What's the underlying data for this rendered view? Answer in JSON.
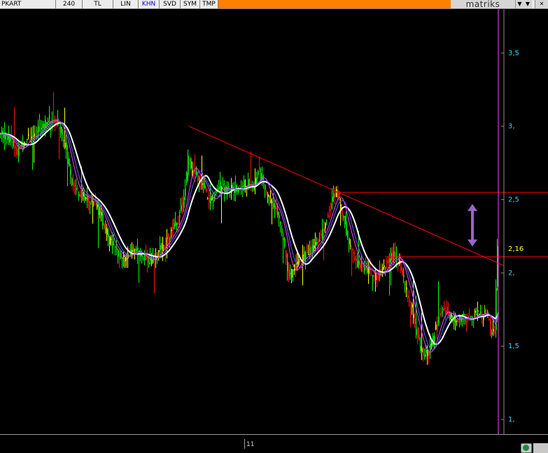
{
  "toolbar": {
    "symbol": "PKART",
    "period": "240",
    "buttons": [
      "TL",
      "LIN",
      "KHN",
      "SVD",
      "SYM",
      "TMP"
    ],
    "active_button": "KHN",
    "brand": "matriks",
    "dropdown_icon": "chevron-down-icon",
    "close_icon": "close-icon",
    "colors": {
      "orange_bar": "#ff7f00"
    }
  },
  "bottom": {
    "x_tick_label": "11",
    "icon": "globe-icon"
  },
  "chart_data": {
    "type": "candlestick",
    "title": "",
    "xlabel": "",
    "ylabel": "",
    "ylim": [
      0.9,
      3.8
    ],
    "yticks": [
      {
        "value": 3.5,
        "label": "3,5"
      },
      {
        "value": 3.0,
        "label": "3,"
      },
      {
        "value": 2.5,
        "label": "2,5"
      },
      {
        "value": 2.0,
        "label": "2,"
      },
      {
        "value": 1.5,
        "label": "1,5"
      },
      {
        "value": 1.0,
        "label": "1,"
      }
    ],
    "last_price": {
      "value": 2.16,
      "label": "2,16"
    },
    "price_path": [
      [
        0,
        2.95
      ],
      [
        10,
        2.93
      ],
      [
        18,
        2.88
      ],
      [
        26,
        2.82
      ],
      [
        34,
        2.88
      ],
      [
        40,
        2.92
      ],
      [
        48,
        2.93
      ],
      [
        56,
        2.97
      ],
      [
        64,
        3.02
      ],
      [
        72,
        3.05
      ],
      [
        80,
        3.04
      ],
      [
        88,
        2.98
      ],
      [
        96,
        2.82
      ],
      [
        104,
        2.62
      ],
      [
        112,
        2.55
      ],
      [
        120,
        2.52
      ],
      [
        130,
        2.5
      ],
      [
        140,
        2.45
      ],
      [
        150,
        2.32
      ],
      [
        158,
        2.22
      ],
      [
        166,
        2.15
      ],
      [
        176,
        2.1
      ],
      [
        186,
        2.13
      ],
      [
        196,
        2.16
      ],
      [
        206,
        2.1
      ],
      [
        216,
        2.08
      ],
      [
        226,
        2.14
      ],
      [
        236,
        2.2
      ],
      [
        246,
        2.28
      ],
      [
        256,
        2.37
      ],
      [
        264,
        2.5
      ],
      [
        270,
        2.78
      ],
      [
        276,
        2.7
      ],
      [
        284,
        2.65
      ],
      [
        292,
        2.6
      ],
      [
        300,
        2.47
      ],
      [
        308,
        2.53
      ],
      [
        316,
        2.6
      ],
      [
        324,
        2.56
      ],
      [
        332,
        2.58
      ],
      [
        340,
        2.56
      ],
      [
        348,
        2.6
      ],
      [
        356,
        2.61
      ],
      [
        364,
        2.58
      ],
      [
        370,
        2.7
      ],
      [
        376,
        2.63
      ],
      [
        384,
        2.52
      ],
      [
        392,
        2.45
      ],
      [
        400,
        2.37
      ],
      [
        408,
        2.15
      ],
      [
        414,
        1.98
      ],
      [
        420,
        2.02
      ],
      [
        428,
        2.08
      ],
      [
        436,
        2.12
      ],
      [
        444,
        2.15
      ],
      [
        452,
        2.2
      ],
      [
        460,
        2.26
      ],
      [
        468,
        2.38
      ],
      [
        476,
        2.5
      ],
      [
        482,
        2.57
      ],
      [
        488,
        2.45
      ],
      [
        496,
        2.28
      ],
      [
        504,
        2.15
      ],
      [
        512,
        2.06
      ],
      [
        520,
        2.03
      ],
      [
        528,
        2.02
      ],
      [
        536,
        1.97
      ],
      [
        544,
        2.0
      ],
      [
        552,
        2.05
      ],
      [
        560,
        2.12
      ],
      [
        568,
        2.11
      ],
      [
        574,
        2.04
      ],
      [
        580,
        1.9
      ],
      [
        588,
        1.78
      ],
      [
        596,
        1.6
      ],
      [
        604,
        1.46
      ],
      [
        612,
        1.44
      ],
      [
        620,
        1.55
      ],
      [
        628,
        1.7
      ],
      [
        636,
        1.76
      ],
      [
        644,
        1.7
      ],
      [
        652,
        1.67
      ],
      [
        660,
        1.7
      ],
      [
        668,
        1.68
      ],
      [
        676,
        1.7
      ],
      [
        684,
        1.73
      ],
      [
        690,
        1.7
      ],
      [
        696,
        1.76
      ],
      [
        702,
        1.6
      ],
      [
        708,
        1.62
      ],
      [
        712,
        2.16
      ]
    ],
    "series": [
      {
        "kind": "moving-average",
        "color": "#ffffff",
        "lag": 14,
        "width": 2
      },
      {
        "kind": "moving-average",
        "color": "#ff40ff",
        "lag": 6,
        "width": 1
      },
      {
        "kind": "moving-average",
        "color": "#6060ff",
        "lag": 9,
        "width": 1
      }
    ],
    "candle_colors": {
      "up": "#00ff00",
      "down": "#ff1010",
      "neutral": "#ffff00"
    },
    "trendline": {
      "from": [
        270,
        3.0
      ],
      "to": [
        720,
        2.05
      ],
      "color": "#ff0000"
    },
    "horizontal_levels": [
      {
        "value": 2.55,
        "from_x": 478,
        "color": "#ff0000"
      },
      {
        "value": 2.11,
        "from_x": 550,
        "color": "#ff0000"
      }
    ],
    "arrow": {
      "x": 675,
      "from": 2.47,
      "to": 2.18,
      "color": "#9966cc"
    },
    "vertical_marker": {
      "x": 712,
      "color": "#ff40ff"
    },
    "grid": false
  }
}
